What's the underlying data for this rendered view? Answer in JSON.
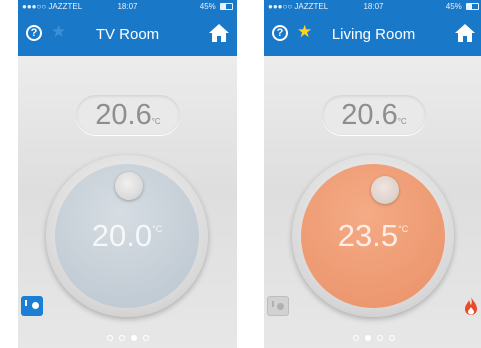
{
  "colors": {
    "header_blue": "#1a78c9",
    "cool_dial": "#bac5ce",
    "warm_dial": "#ea9067",
    "flame": "#e84a2a",
    "star_active": "#ffd21f"
  },
  "screens": [
    {
      "status": {
        "carrier": "●●●○○ JAZZTEL",
        "time": "18:07",
        "battery": "45%",
        "battery_fraction": 0.45
      },
      "nav": {
        "help_label": "?",
        "favorite_icon": "star-icon",
        "favorite_active": false,
        "title": "TV Room",
        "home_icon": "home-icon"
      },
      "current_temp": {
        "value": "20.6",
        "unit": "°C"
      },
      "setpoint": {
        "value": "20.0",
        "unit": "°C"
      },
      "mode": {
        "icon": "mode-switch-icon",
        "active": true
      },
      "heating": false,
      "page": {
        "count": 4,
        "current": 3
      }
    },
    {
      "status": {
        "carrier": "●●●○○ JAZZTEL",
        "time": "18:07",
        "battery": "45%",
        "battery_fraction": 0.45
      },
      "nav": {
        "help_label": "?",
        "favorite_icon": "star-icon",
        "favorite_active": true,
        "title": "Living Room",
        "home_icon": "home-icon"
      },
      "current_temp": {
        "value": "20.6",
        "unit": "°C"
      },
      "setpoint": {
        "value": "23.5",
        "unit": "°C"
      },
      "mode": {
        "icon": "mode-switch-icon",
        "active": false
      },
      "heating": true,
      "page": {
        "count": 4,
        "current": 2
      }
    }
  ]
}
